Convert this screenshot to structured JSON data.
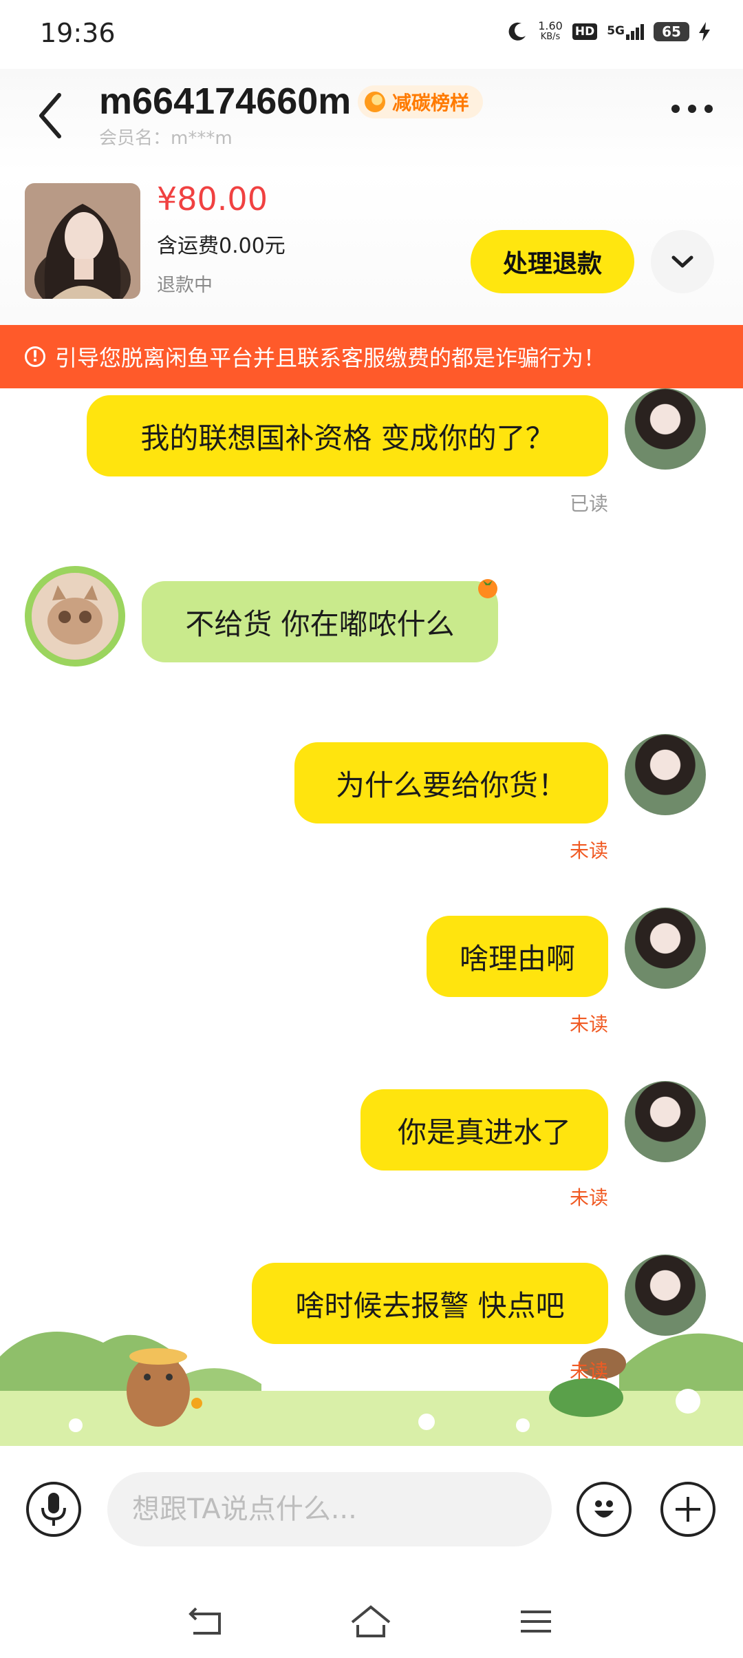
{
  "status_bar": {
    "time": "19:36",
    "net_speed_value": "1.60",
    "net_speed_unit": "KB/s",
    "hd_label": "HD",
    "signal_label": "5G",
    "battery": "65"
  },
  "header": {
    "title": "m664174660m",
    "badge": "减碳榜样",
    "member": "会员名：m***m"
  },
  "product": {
    "price": "¥80.00",
    "shipping": "含运费0.00元",
    "status": "退款中",
    "action": "处理退款"
  },
  "warning": {
    "text": "引导您脱离闲鱼平台并且联系客服缴费的都是诈骗行为！"
  },
  "messages": [
    {
      "direction": "out",
      "text": "我的联想国补资格 变成你的了？",
      "read_status": "已读"
    },
    {
      "direction": "in",
      "text": "不给货 你在嘟哝什么"
    },
    {
      "direction": "out",
      "text": "为什么要给你货！",
      "read_status": "未读"
    },
    {
      "direction": "out",
      "text": "啥理由啊",
      "read_status": "未读"
    },
    {
      "direction": "out",
      "text": "你是真进水了",
      "read_status": "未读"
    },
    {
      "direction": "out",
      "text": "啥时候去报警 快点吧",
      "read_status": "未读"
    }
  ],
  "input": {
    "placeholder": "想跟TA说点什么..."
  },
  "colors": {
    "accent_yellow": "#ffe40e",
    "incoming_bubble": "#c9ea8c",
    "warning_bg": "#ff5a2a",
    "price_red": "#f04141",
    "unread_orange": "#f05a23"
  }
}
